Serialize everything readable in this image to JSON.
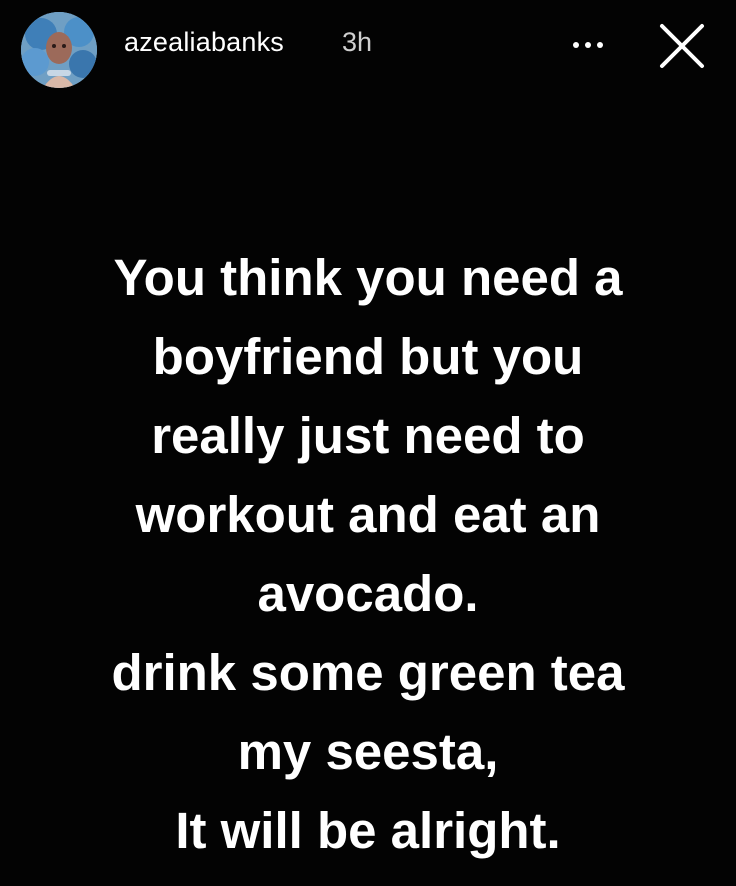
{
  "story": {
    "username": "azealiabanks",
    "timestamp": "3h",
    "icons": {
      "avatar": "profile-avatar",
      "more": "more-options-icon",
      "close": "close-icon"
    },
    "message_lines": [
      "You think you need a",
      "boyfriend but you",
      "really just need to",
      "workout and eat an",
      "avocado.",
      "drink some green tea",
      "my seesta,",
      "It will be alright."
    ]
  },
  "colors": {
    "background": "#030303",
    "text": "#ffffff",
    "timestamp": "#cfcfcf"
  }
}
